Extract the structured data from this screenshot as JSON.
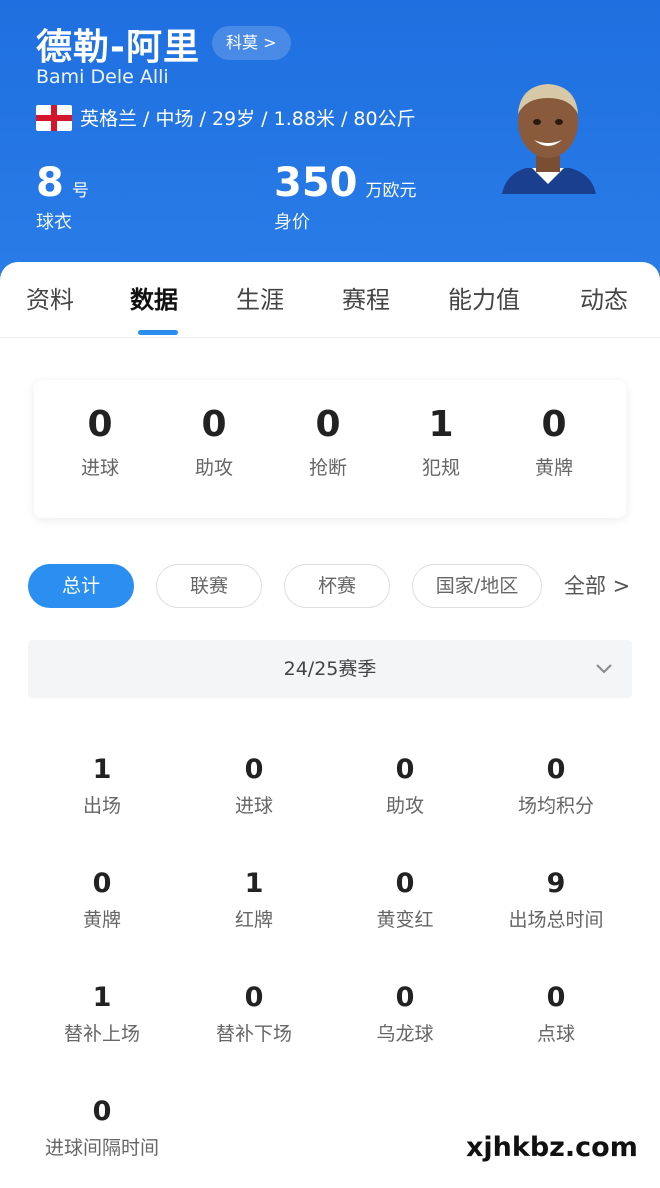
{
  "player": {
    "name": "德勒-阿里",
    "club_pill": "科莫 >",
    "english_name": "Bami Dele Alli",
    "info": "英格兰 / 中场 / 29岁 / 1.88米 / 80公斤",
    "shirt": {
      "value": "8",
      "unit": "号",
      "caption": "球衣"
    },
    "value": {
      "value": "350",
      "unit": "万欧元",
      "caption": "身价"
    }
  },
  "tabs": [
    "资料",
    "数据",
    "生涯",
    "赛程",
    "能力值",
    "动态"
  ],
  "active_tab": 1,
  "summary": [
    {
      "value": "0",
      "label": "进球"
    },
    {
      "value": "0",
      "label": "助攻"
    },
    {
      "value": "0",
      "label": "抢断"
    },
    {
      "value": "1",
      "label": "犯规"
    },
    {
      "value": "0",
      "label": "黄牌"
    }
  ],
  "filters": [
    "总计",
    "联赛",
    "杯赛",
    "国家/地区"
  ],
  "filter_all": "全部 >",
  "season": "24/25赛季",
  "details": [
    {
      "value": "1",
      "label": "出场"
    },
    {
      "value": "0",
      "label": "进球"
    },
    {
      "value": "0",
      "label": "助攻"
    },
    {
      "value": "0",
      "label": "场均积分"
    },
    {
      "value": "0",
      "label": "黄牌"
    },
    {
      "value": "1",
      "label": "红牌"
    },
    {
      "value": "0",
      "label": "黄变红"
    },
    {
      "value": "9",
      "label": "出场总时间"
    },
    {
      "value": "1",
      "label": "替补上场"
    },
    {
      "value": "0",
      "label": "替补下场"
    },
    {
      "value": "0",
      "label": "乌龙球"
    },
    {
      "value": "0",
      "label": "点球"
    },
    {
      "value": "0",
      "label": "进球间隔时间"
    }
  ],
  "watermark": "xjhkbz.com",
  "colors": {
    "header_blue": "#2a7de8",
    "accent": "#2a8ff0"
  }
}
